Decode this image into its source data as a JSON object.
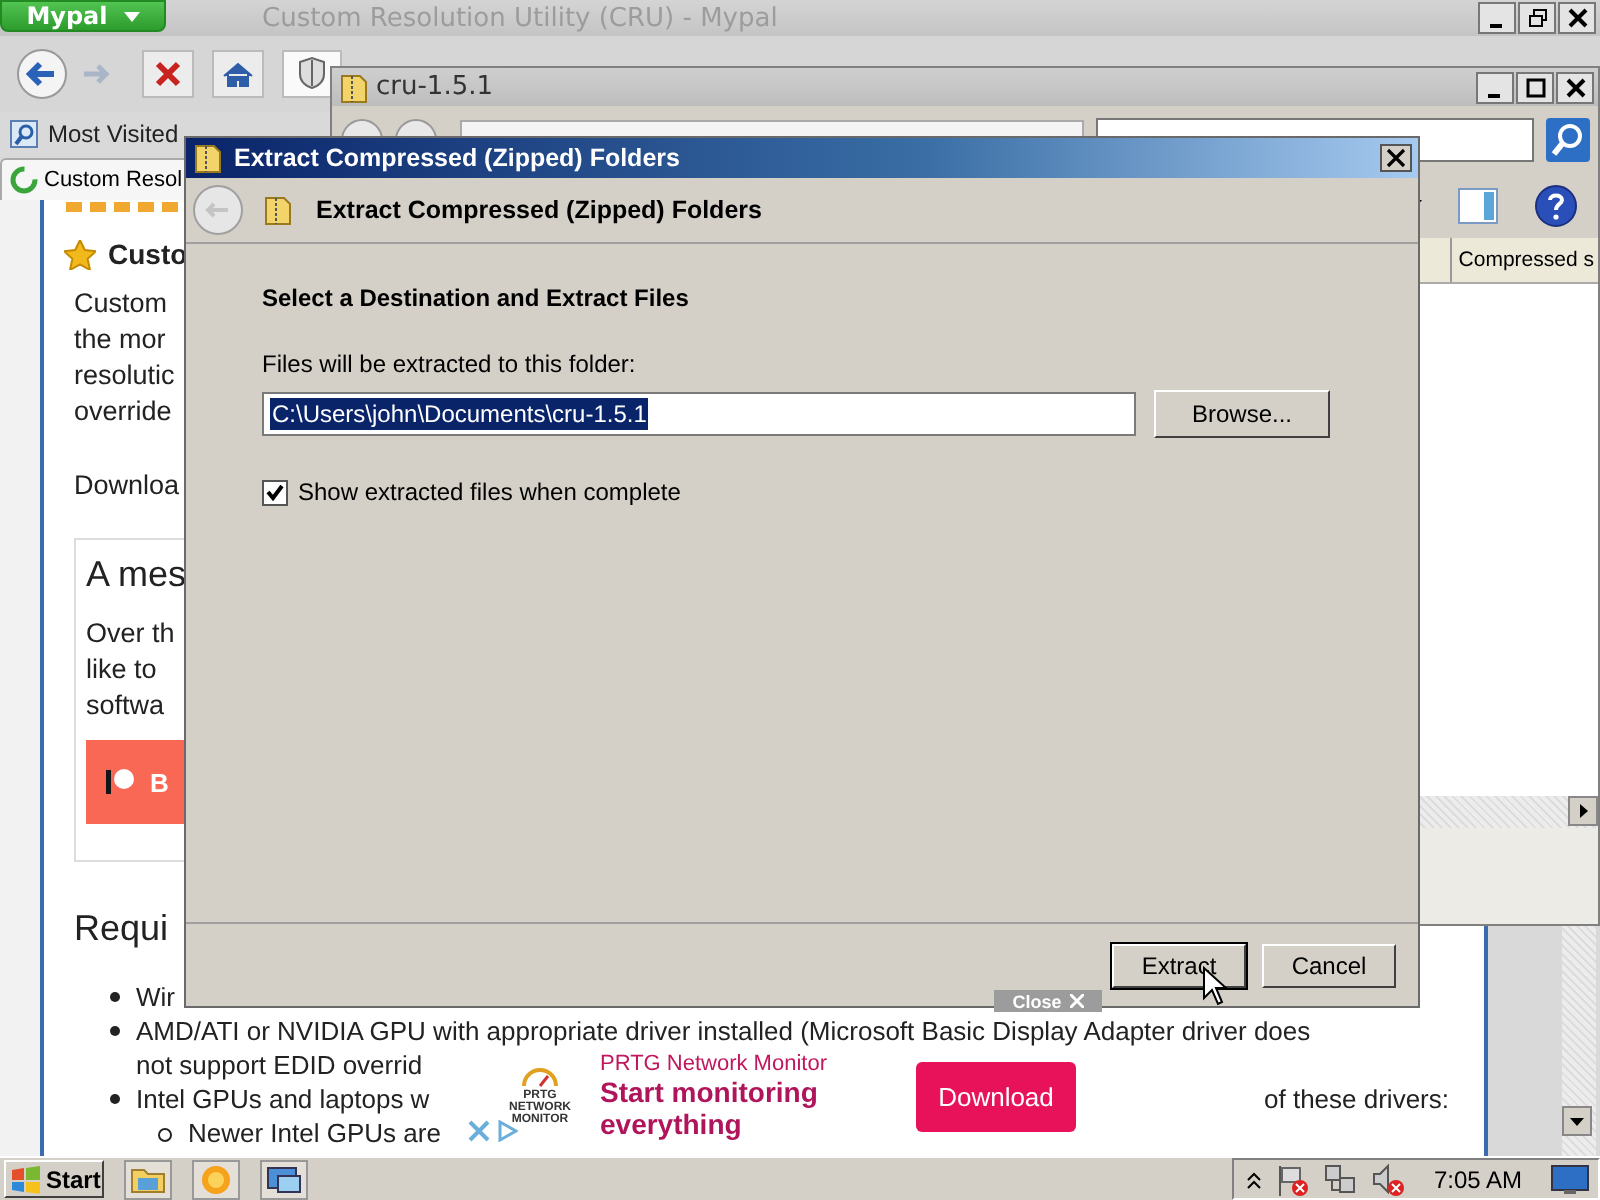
{
  "browser": {
    "menu_button": "Mypal",
    "title": "Custom Resolution Utility (CRU) - Mypal",
    "bookmarks": [
      {
        "label": "Most Visited"
      }
    ],
    "tabs": [
      {
        "label": "Custom Resol",
        "selected": true
      }
    ],
    "page": {
      "heading": "Custo",
      "intro_lines": [
        "Custom",
        "the mor",
        "resolutic",
        "override"
      ],
      "download_line": "Downloa",
      "message_box": {
        "heading": "A mes",
        "lines": [
          "Over th",
          "like to",
          "softwa"
        ],
        "button": "B"
      },
      "requirements_heading": "Requi",
      "requirements": [
        {
          "lines": [
            [
              "Wir"
            ]
          ]
        },
        {
          "lines": [
            [
              "AMD/ATI or NVIDIA GPU with appropriate driver installed (Microsoft Basic Display Adapter driver does"
            ],
            [
              "not support EDID overrid"
            ]
          ]
        },
        {
          "lines": [
            [
              "Intel GPUs and laptops w",
              "of these drivers:"
            ]
          ],
          "children": [
            {
              "lines": [
                [
                  "Newer Intel GPUs are"
                ]
              ]
            }
          ]
        }
      ]
    }
  },
  "explorer": {
    "title": "cru-1.5.1",
    "columns": [
      {
        "label": "Compressed s"
      }
    ]
  },
  "dialog": {
    "title": "Extract Compressed (Zipped) Folders",
    "header": "Extract Compressed (Zipped) Folders",
    "heading": "Select a Destination and Extract Files",
    "field_label": "Files will be extracted to this folder:",
    "path": {
      "value": "C:\\Users\\john\\Documents\\cru-1.5.1",
      "selected": true
    },
    "browse_button": "Browse...",
    "checkbox": {
      "label": "Show extracted files when complete",
      "checked": true
    },
    "buttons": [
      {
        "label": "Extract",
        "default": true
      },
      {
        "label": "Cancel",
        "default": false
      }
    ]
  },
  "ad": {
    "close_label": "Close",
    "logo_text": "PRTG NETWORK MONITOR",
    "brand": "PRTG Network Monitor",
    "headline": "Start monitoring everything",
    "button": "Download"
  },
  "taskbar": {
    "start": "Start",
    "clock": "7:05 AM"
  }
}
